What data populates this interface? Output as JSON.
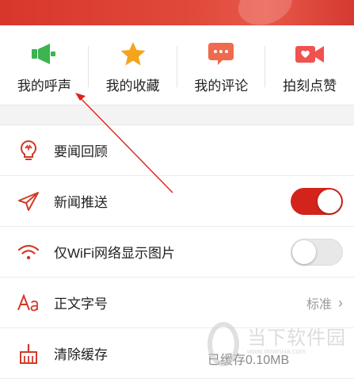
{
  "quick_actions": [
    {
      "label": "我的呼声",
      "icon": "megaphone-icon",
      "color": "#3cb450"
    },
    {
      "label": "我的收藏",
      "icon": "star-icon",
      "color": "#f3a51e"
    },
    {
      "label": "我的评论",
      "icon": "comment-icon",
      "color": "#f06a4e"
    },
    {
      "label": "拍刻点赞",
      "icon": "video-camera-icon",
      "color": "#f0524e"
    }
  ],
  "settings": [
    {
      "label": "要闻回顾",
      "icon": "lightbulb-icon"
    },
    {
      "label": "新闻推送",
      "icon": "send-icon",
      "toggle": true
    },
    {
      "label": "仅WiFi网络显示图片",
      "icon": "wifi-icon",
      "toggle": false
    },
    {
      "label": "正文字号",
      "icon": "font-size-icon",
      "value": "标准"
    },
    {
      "label": "清除缓存",
      "icon": "broom-icon",
      "value": "已缓存0.10MB"
    }
  ],
  "watermark": {
    "text": "当下软件园",
    "url": "www.downxia.com"
  },
  "colors": {
    "accent": "#d3241c",
    "icon_red": "#d23a2a"
  }
}
